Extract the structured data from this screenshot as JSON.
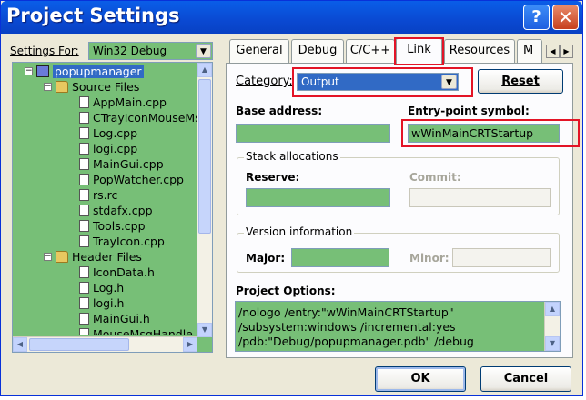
{
  "window": {
    "title": "Project Settings",
    "help_glyph": "?",
    "close_glyph": "✕"
  },
  "settings_for": {
    "label": "Settings For:",
    "value": "Win32 Debug"
  },
  "tree": {
    "project": "popupmanager",
    "source_folder": "Source Files",
    "source_files": [
      "AppMain.cpp",
      "CTrayIconMouseMsg",
      "Log.cpp",
      "logi.cpp",
      "MainGui.cpp",
      "PopWatcher.cpp",
      "rs.rc",
      "stdafx.cpp",
      "Tools.cpp",
      "TrayIcon.cpp"
    ],
    "header_folder": "Header Files",
    "header_files": [
      "IconData.h",
      "Log.h",
      "logi.h",
      "MainGui.h",
      "MouseMsgHandle"
    ]
  },
  "tabs": [
    "General",
    "Debug",
    "C/C++",
    "Link",
    "Resources",
    "M"
  ],
  "active_tab": "Link",
  "category": {
    "label": "Category:",
    "value": "Output"
  },
  "reset_label": "Reset",
  "base_address": {
    "label": "Base address:",
    "value": ""
  },
  "entry_point": {
    "label": "Entry-point symbol:",
    "value": "wWinMainCRTStartup"
  },
  "stack": {
    "title": "Stack allocations",
    "reserve_label": "Reserve:",
    "commit_label": "Commit:"
  },
  "version": {
    "title": "Version information",
    "major_label": "Major:",
    "minor_label": "Minor:"
  },
  "project_options": {
    "label": "Project Options:",
    "lines": [
      "/nologo /entry:\"wWinMainCRTStartup\"",
      "/subsystem:windows /incremental:yes",
      "/pdb:\"Debug/popupmanager.pdb\" /debug"
    ]
  },
  "buttons": {
    "ok": "OK",
    "cancel": "Cancel"
  },
  "colors": {
    "field_fill": "#77bf77",
    "highlight": "#e31426",
    "titlebar": "#0a5ee8"
  }
}
